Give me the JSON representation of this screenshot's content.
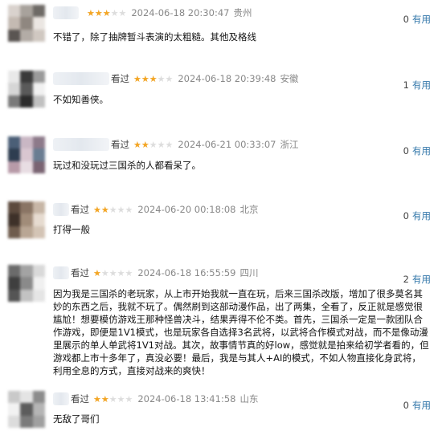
{
  "reviews": [
    {
      "user_prefix": "",
      "rating": 3,
      "date": "2024-06-18 20:30:47",
      "location": "贵州",
      "useful_count": "0",
      "useful_label": "有用",
      "content": "不错了，除了抽牌暂斗表演的太粗糙。其他及格线"
    },
    {
      "user_prefix": "看过",
      "rating": 3,
      "date": "2024-06-18 20:39:48",
      "location": "安徽",
      "useful_count": "1",
      "useful_label": "有用",
      "content": "不如知善侠。"
    },
    {
      "user_prefix": "看过",
      "rating": 2,
      "date": "2024-06-21 00:33:07",
      "location": "浙江",
      "useful_count": "0",
      "useful_label": "有用",
      "content": "玩过和没玩过三国杀的人都看呆了。"
    },
    {
      "user_prefix": "看过",
      "rating": 2,
      "date": "2024-06-20 00:18:08",
      "location": "北京",
      "useful_count": "0",
      "useful_label": "有用",
      "content": "打得一般"
    },
    {
      "user_prefix": "看过",
      "rating": 1,
      "date": "2024-06-18 16:55:59",
      "location": "四川",
      "useful_count": "2",
      "useful_label": "有用",
      "content": "因为我是三国杀的老玩家，从上市开始我就一直在玩，后来三国杀改版，增加了很多莫名其妙的东西之后，我就不玩了。偶然刷到这部动漫作品，出了两集，全看了，反正就是感觉很尴尬！想要模仿游戏王那种怪兽决斗，结果弄得不伦不类。首先，三国杀一定是一款团队合作游戏，即便是1V1模式，也是玩家各自选择3名武将，以武将合作模式对战，而不是像动漫里展示的单人单武将1V1对战。其次，故事情节真的好low，感觉就是拍来给初学者看的，但游戏都上市十多年了，真没必要！最后，我是与其人+AI的模式，不如人物直接化身武将，利用全息的方式，直接对战来的爽快！"
    },
    {
      "user_prefix": "看过",
      "rating": 2,
      "date": "2024-06-18 13:41:58",
      "location": "山东",
      "useful_count": "0",
      "useful_label": "有用",
      "content": "无敌了哥们"
    }
  ]
}
